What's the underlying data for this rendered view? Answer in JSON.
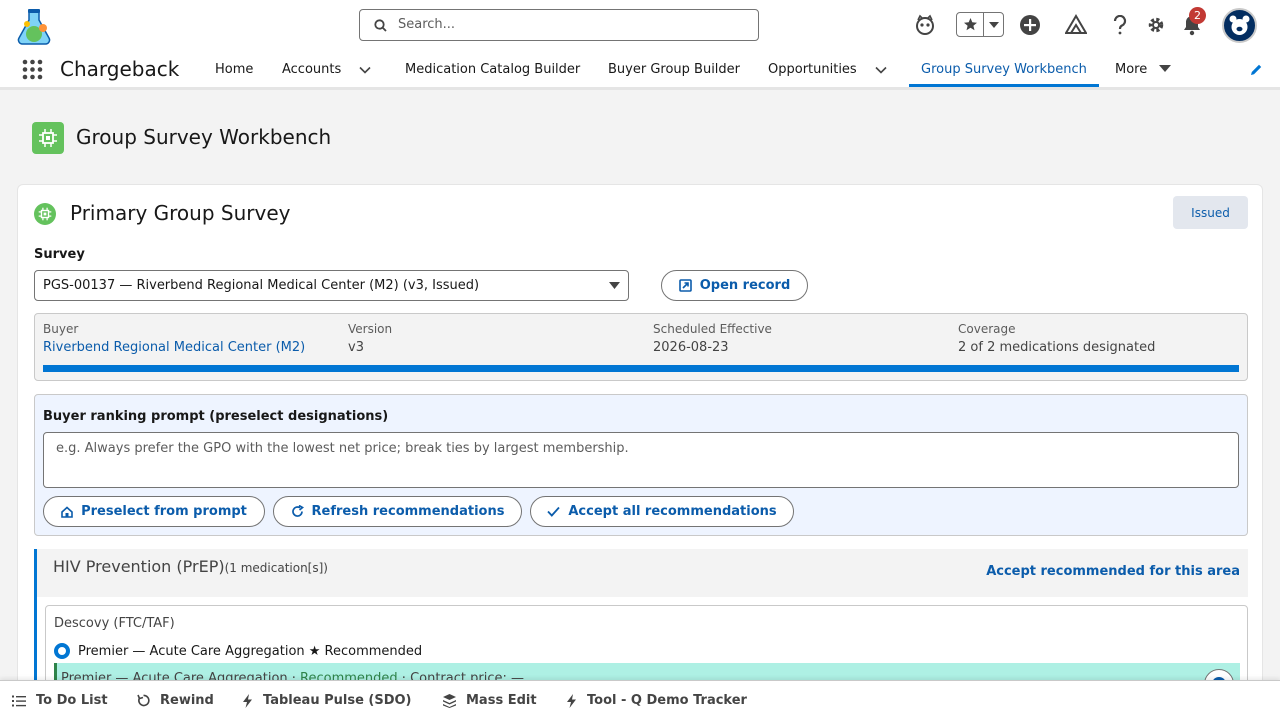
{
  "header": {
    "search_placeholder": "Search...",
    "notification_count": "2"
  },
  "nav": {
    "app_name": "Chargeback",
    "items": [
      {
        "label": "Home"
      },
      {
        "label": "Accounts"
      },
      {
        "label": "Medication Catalog Builder"
      },
      {
        "label": "Buyer Group Builder"
      },
      {
        "label": "Opportunities"
      },
      {
        "label": "Group Survey Workbench"
      },
      {
        "label": "More"
      }
    ],
    "active": "Group Survey Workbench"
  },
  "page": {
    "title": "Group Survey Workbench"
  },
  "card": {
    "title": "Primary Group Survey",
    "status": "Issued",
    "survey_label": "Survey",
    "survey_value": "PGS-00137 — Riverbend Regional Medical Center (M2) (v3, Issued)",
    "open_record_label": "Open record",
    "summary": {
      "buyer_label": "Buyer",
      "buyer_value": "Riverbend Regional Medical Center (M2)",
      "version_label": "Version",
      "version_value": "v3",
      "effective_label": "Scheduled Effective",
      "effective_value": "2026-08-23",
      "coverage_label": "Coverage",
      "coverage_value": "2 of 2 medications designated",
      "coverage_progress": 1.0
    },
    "prompt": {
      "title": "Buyer ranking prompt (preselect designations)",
      "placeholder": "e.g. Always prefer the GPO with the lowest net price; break ties by largest membership.",
      "preselect_label": "Preselect from prompt",
      "refresh_label": "Refresh recommendations",
      "accept_all_label": "Accept all recommendations"
    },
    "area": {
      "name": "HIV Prevention (PrEP)",
      "count": "(1 medication[s])",
      "accept_label": "Accept recommended for this area"
    },
    "medication": {
      "name": "Descovy (FTC/TAF)",
      "option_label": "Premier — Acute Care Aggregation ★ Recommended",
      "strip_prefix": "Premier — Acute Care Aggregation · ",
      "strip_recommended": "Recommended",
      "strip_suffix": " · Contract price: —"
    }
  },
  "utility_bar": {
    "items": [
      {
        "label": "To Do List",
        "icon": "list-icon"
      },
      {
        "label": "Rewind",
        "icon": "rewind-icon"
      },
      {
        "label": "Tableau Pulse (SDO)",
        "icon": "bolt-icon"
      },
      {
        "label": "Mass Edit",
        "icon": "layers-icon"
      },
      {
        "label": "Tool - Q Demo Tracker",
        "icon": "bolt-icon"
      }
    ]
  },
  "colors": {
    "brand": "#0176d3",
    "link": "#0b5cab",
    "page_icon_green": "#64c25d",
    "recommended_strip": "#aef0e4"
  }
}
